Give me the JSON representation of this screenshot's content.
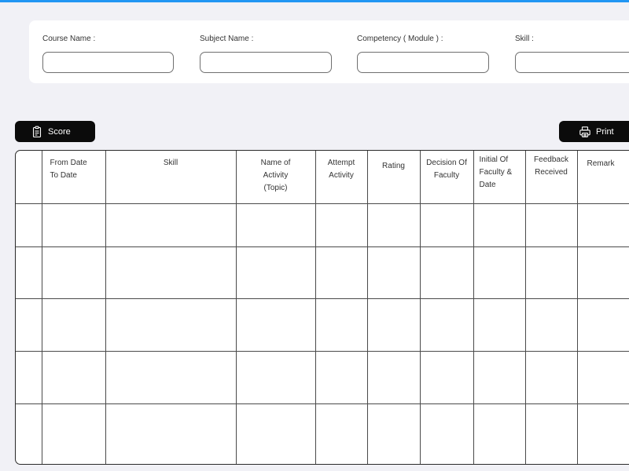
{
  "filters": {
    "course_name_label": "Course Name :",
    "subject_name_label": "Subject Name :",
    "competency_label": "Competency ( Module ) :",
    "skill_label": "Skill :",
    "course_name_value": "",
    "subject_name_value": "",
    "competency_value": "",
    "skill_value": ""
  },
  "toolbar": {
    "score_label": "Score",
    "print_label": "Print"
  },
  "icons": {
    "score": "clipboard-icon",
    "print": "printer-icon"
  },
  "colors": {
    "accent_topbar": "#2196f3",
    "button_bg": "#0b0b0b",
    "page_bg": "#f1f1f6"
  },
  "table": {
    "columns": [
      "",
      "From Date\nTo Date",
      "Skill",
      "Name of\nActivity\n(Topic)",
      "Attempt\nActivity",
      "Rating",
      "Decision Of\nFaculty",
      "Initial Of\nFaculty &\nDate",
      "Feedback\nReceived",
      "Remark"
    ],
    "rows": [
      [
        "",
        "",
        "",
        "",
        "",
        "",
        "",
        "",
        "",
        ""
      ],
      [
        "",
        "",
        "",
        "",
        "",
        "",
        "",
        "",
        "",
        ""
      ],
      [
        "",
        "",
        "",
        "",
        "",
        "",
        "",
        "",
        "",
        ""
      ],
      [
        "",
        "",
        "",
        "",
        "",
        "",
        "",
        "",
        "",
        ""
      ],
      [
        "",
        "",
        "",
        "",
        "",
        "",
        "",
        "",
        "",
        ""
      ]
    ]
  }
}
